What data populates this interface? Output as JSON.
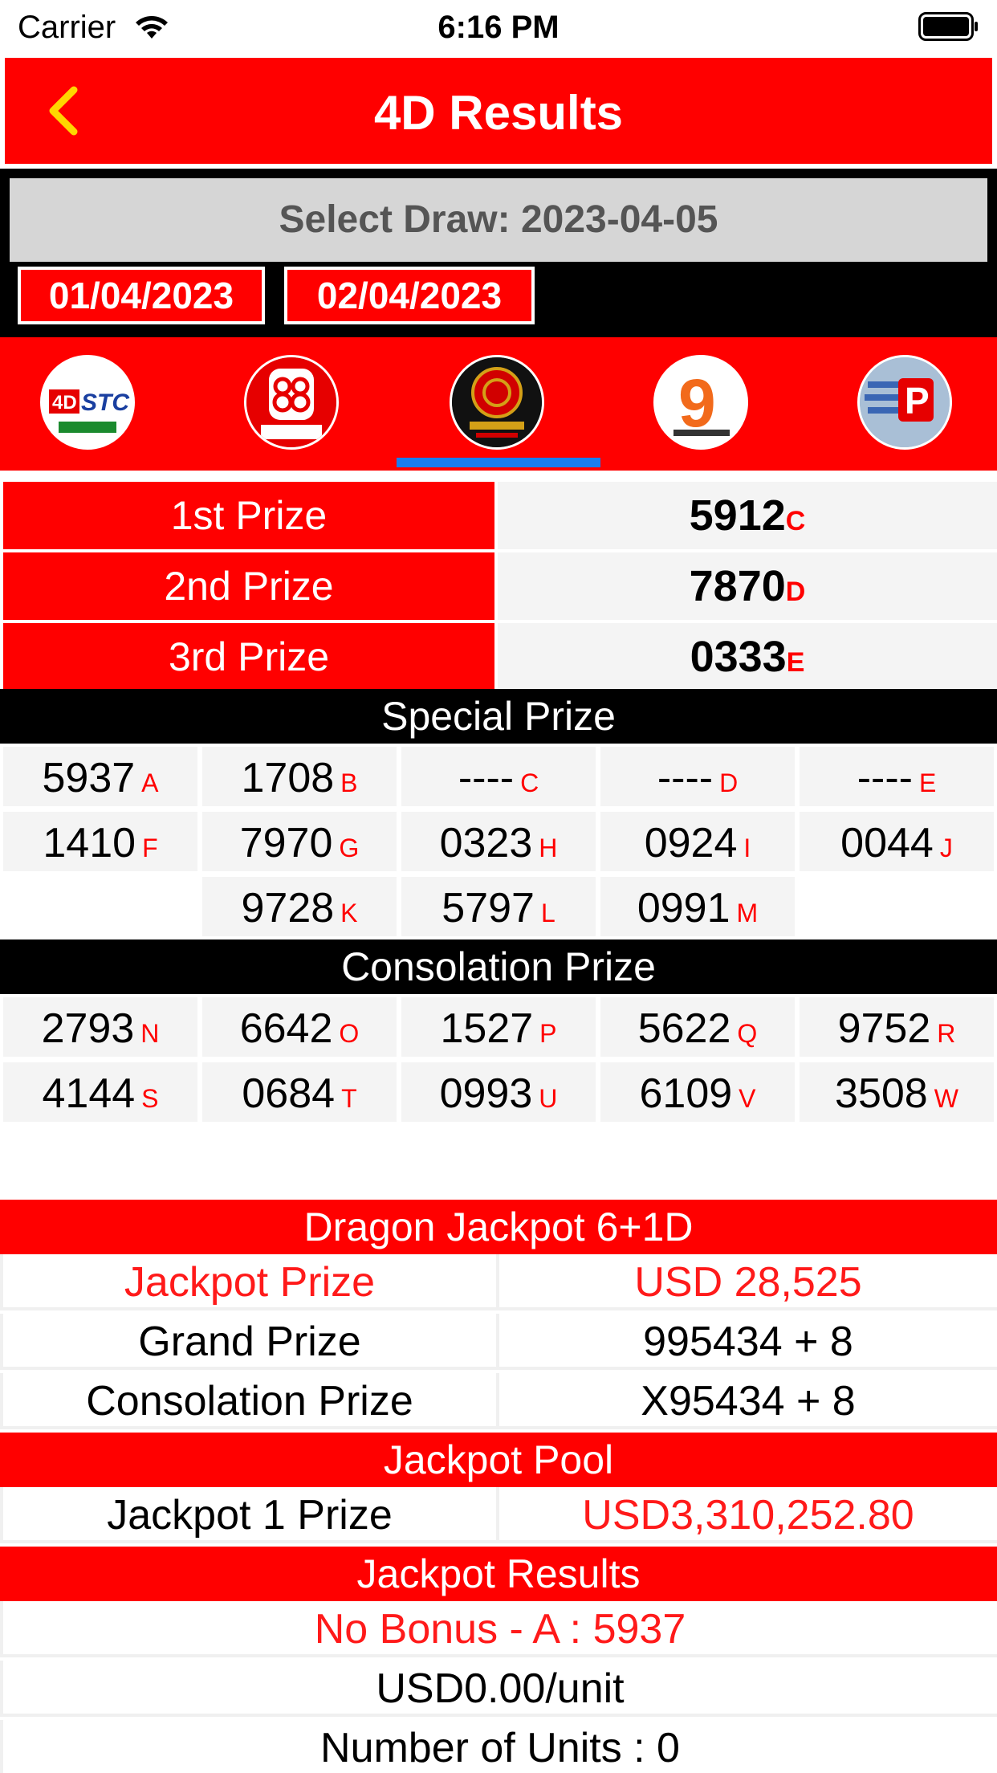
{
  "status_bar": {
    "carrier": "Carrier",
    "time": "6:16 PM"
  },
  "nav": {
    "title": "4D Results"
  },
  "draw": {
    "select_label": "Select Draw: 2023-04-05",
    "dates": [
      "01/04/2023",
      "02/04/2023"
    ]
  },
  "operators": [
    {
      "name": "4D STC",
      "icon": "stc-logo-icon"
    },
    {
      "name": "Sabah 88",
      "icon": "sabah88-logo-icon"
    },
    {
      "name": "Grand Dragon Lotto",
      "icon": "grand-dragon-logo-icon",
      "selected": true
    },
    {
      "name": "9 Lotto",
      "icon": "nine-lotto-logo-icon"
    },
    {
      "name": "Perdana",
      "icon": "perdana-logo-icon"
    }
  ],
  "top_prizes": [
    {
      "label": "1st Prize",
      "number": "5912",
      "tag": "C"
    },
    {
      "label": "2nd Prize",
      "number": "7870",
      "tag": "D"
    },
    {
      "label": "3rd Prize",
      "number": "0333",
      "tag": "E"
    }
  ],
  "special": {
    "title": "Special Prize",
    "rows": [
      [
        {
          "n": "5937",
          "t": "A"
        },
        {
          "n": "1708",
          "t": "B"
        },
        {
          "n": "----",
          "t": "C"
        },
        {
          "n": "----",
          "t": "D"
        },
        {
          "n": "----",
          "t": "E"
        }
      ],
      [
        {
          "n": "1410",
          "t": "F"
        },
        {
          "n": "7970",
          "t": "G"
        },
        {
          "n": "0323",
          "t": "H"
        },
        {
          "n": "0924",
          "t": "I"
        },
        {
          "n": "0044",
          "t": "J"
        }
      ],
      [
        {
          "n": "",
          "t": ""
        },
        {
          "n": "9728",
          "t": "K"
        },
        {
          "n": "5797",
          "t": "L"
        },
        {
          "n": "0991",
          "t": "M"
        },
        {
          "n": "",
          "t": ""
        }
      ]
    ]
  },
  "consolation": {
    "title": "Consolation Prize",
    "rows": [
      [
        {
          "n": "2793",
          "t": "N"
        },
        {
          "n": "6642",
          "t": "O"
        },
        {
          "n": "1527",
          "t": "P"
        },
        {
          "n": "5622",
          "t": "Q"
        },
        {
          "n": "9752",
          "t": "R"
        }
      ],
      [
        {
          "n": "4144",
          "t": "S"
        },
        {
          "n": "0684",
          "t": "T"
        },
        {
          "n": "0993",
          "t": "U"
        },
        {
          "n": "6109",
          "t": "V"
        },
        {
          "n": "3508",
          "t": "W"
        }
      ]
    ]
  },
  "jackpot": {
    "title": "Dragon Jackpot 6+1D",
    "rows": [
      {
        "label": "Jackpot Prize",
        "value": "USD 28,525"
      },
      {
        "label": "Grand Prize",
        "value": "995434 + 8"
      },
      {
        "label": "Consolation Prize",
        "value": "X95434 + 8"
      }
    ],
    "pool_title": "Jackpot Pool",
    "pool": {
      "label": "Jackpot 1 Prize",
      "value": "USD3,310,252.80"
    },
    "results_title": "Jackpot Results",
    "results": [
      "No Bonus - A : 5937",
      "USD0.00/unit",
      "Number of Units : 0"
    ]
  },
  "colors": {
    "primary": "#ff0000",
    "accent_text": "#ff1a1a",
    "selected_indicator": "#1a7df0",
    "header_black": "#000000"
  }
}
